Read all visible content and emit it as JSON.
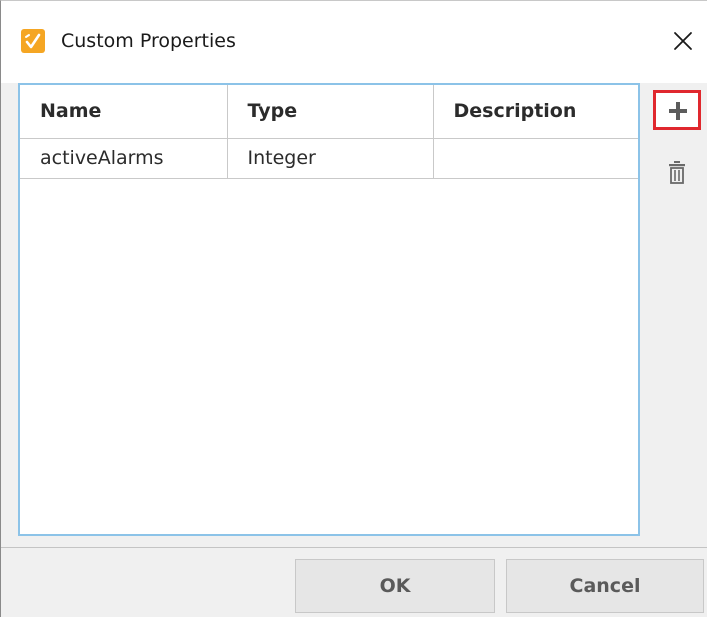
{
  "window": {
    "title": "Custom Properties"
  },
  "table": {
    "columns": [
      "Name",
      "Type",
      "Description"
    ],
    "rows": [
      {
        "name": "activeAlarms",
        "type": "Integer",
        "description": ""
      }
    ]
  },
  "toolbar": {
    "add_icon": "plus-icon",
    "delete_icon": "trash-icon"
  },
  "footer": {
    "ok_label": "OK",
    "cancel_label": "Cancel"
  },
  "colors": {
    "app_icon": "#f5a623",
    "table_border": "#8cc3e8",
    "add_highlight": "#e0282e",
    "button_bg": "#e6e6e6"
  }
}
